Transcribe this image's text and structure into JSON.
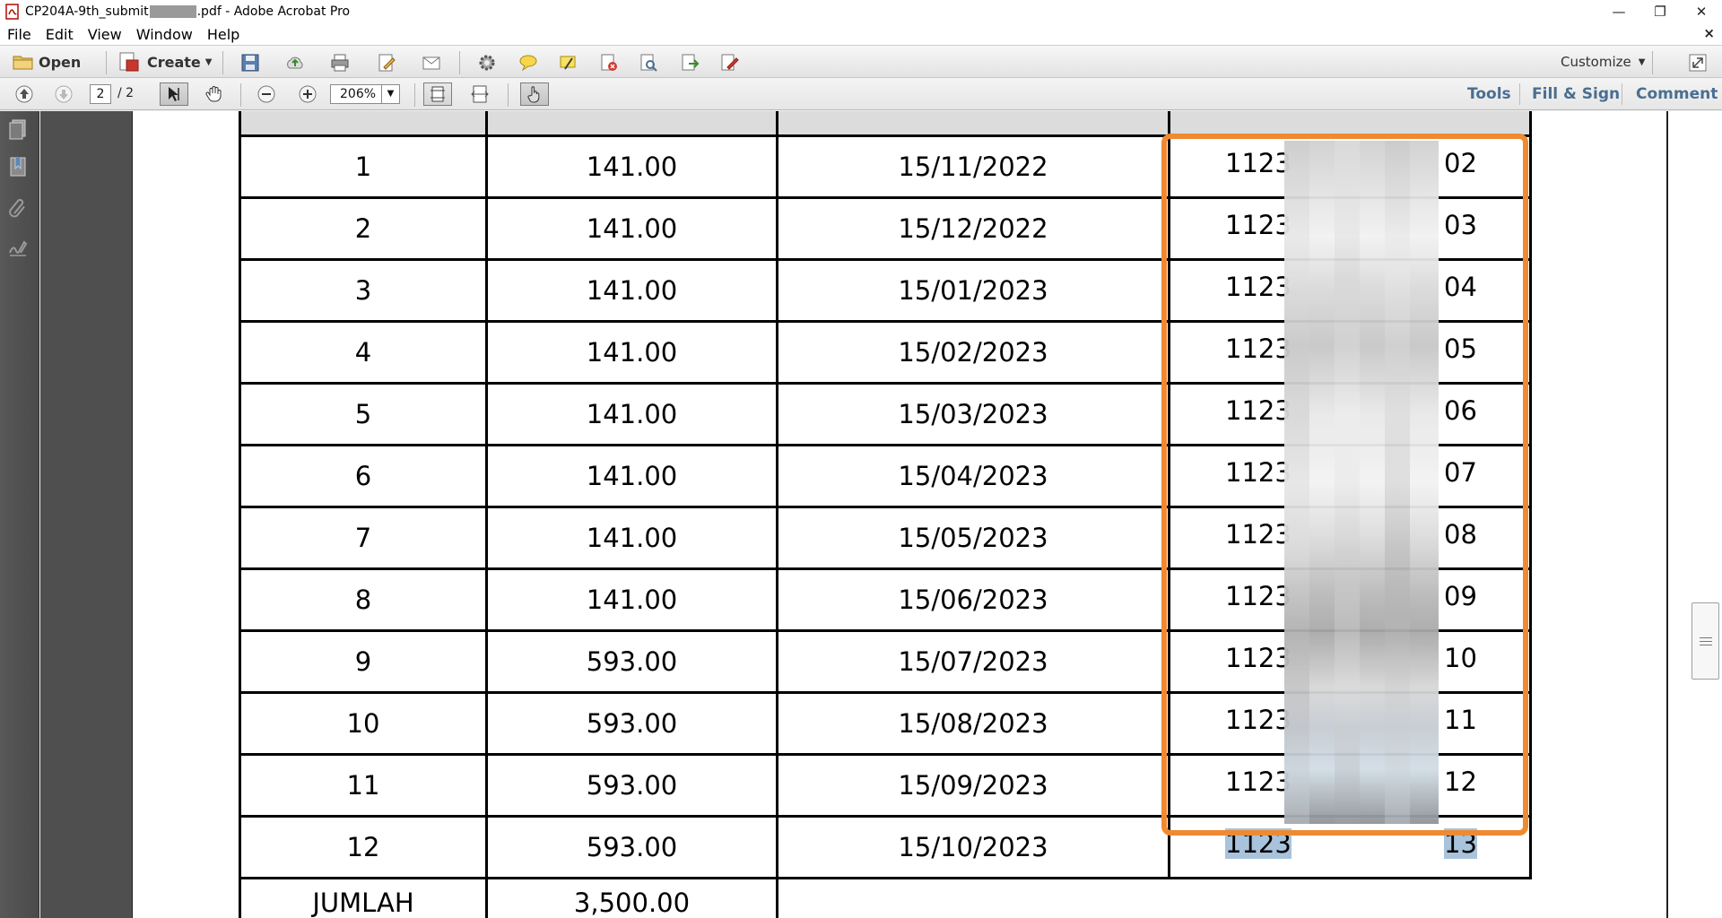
{
  "window": {
    "title_prefix": "CP204A-9th_submit",
    "title_suffix": ".pdf - Adobe Acrobat Pro",
    "controls": {
      "minimize": "—",
      "restore": "❐",
      "close": "✕"
    }
  },
  "menu": {
    "items": [
      "File",
      "Edit",
      "View",
      "Window",
      "Help"
    ],
    "close_doc": "×"
  },
  "toolbar": {
    "open_label": "Open",
    "create_label": "Create",
    "customize_label": "Customize"
  },
  "nav": {
    "current_page": "2",
    "page_total": "/ 2",
    "zoom": "206%",
    "tools_label": "Tools",
    "fill_sign_label": "Fill & Sign",
    "comment_label": "Comment"
  },
  "table": {
    "rows": [
      {
        "no": "1",
        "amount": "141.00",
        "date": "15/11/2022",
        "ref_prefix": "1123",
        "ref_suffix": "02"
      },
      {
        "no": "2",
        "amount": "141.00",
        "date": "15/12/2022",
        "ref_prefix": "1123",
        "ref_suffix": "03"
      },
      {
        "no": "3",
        "amount": "141.00",
        "date": "15/01/2023",
        "ref_prefix": "1123",
        "ref_suffix": "04"
      },
      {
        "no": "4",
        "amount": "141.00",
        "date": "15/02/2023",
        "ref_prefix": "1123",
        "ref_suffix": "05"
      },
      {
        "no": "5",
        "amount": "141.00",
        "date": "15/03/2023",
        "ref_prefix": "1123",
        "ref_suffix": "06"
      },
      {
        "no": "6",
        "amount": "141.00",
        "date": "15/04/2023",
        "ref_prefix": "1123",
        "ref_suffix": "07"
      },
      {
        "no": "7",
        "amount": "141.00",
        "date": "15/05/2023",
        "ref_prefix": "1123",
        "ref_suffix": "08"
      },
      {
        "no": "8",
        "amount": "141.00",
        "date": "15/06/2023",
        "ref_prefix": "1123",
        "ref_suffix": "09"
      },
      {
        "no": "9",
        "amount": "593.00",
        "date": "15/07/2023",
        "ref_prefix": "1123",
        "ref_suffix": "10"
      },
      {
        "no": "10",
        "amount": "593.00",
        "date": "15/08/2023",
        "ref_prefix": "1123",
        "ref_suffix": "11"
      },
      {
        "no": "11",
        "amount": "593.00",
        "date": "15/09/2023",
        "ref_prefix": "1123",
        "ref_suffix": "12"
      },
      {
        "no": "12",
        "amount": "593.00",
        "date": "15/10/2023",
        "ref_prefix": "1123",
        "ref_suffix": "13"
      }
    ],
    "total_label": "JUMLAH",
    "total_amount": "3,500.00"
  },
  "colors": {
    "highlight_border": "#ee8a32",
    "selection": "#a8c3db",
    "link_blue": "#4a6e91"
  }
}
